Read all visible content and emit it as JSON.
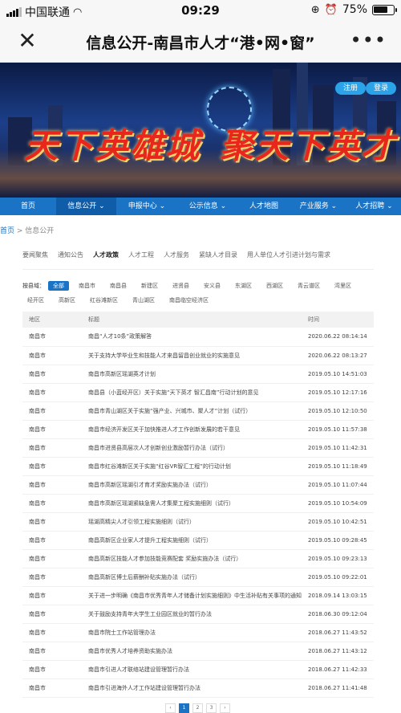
{
  "status_bar": {
    "carrier": "中国联通",
    "time": "09:29",
    "battery_text": "75%",
    "battery_level": 0.75,
    "icons": [
      "signal-icon",
      "wifi-icon",
      "rotation-lock-icon",
      "alarm-icon",
      "battery-icon"
    ]
  },
  "navbar": {
    "title": "信息公开-南昌市人才“港•网•窗”",
    "close_icon": "close-icon",
    "more_icon": "more-icon"
  },
  "banner": {
    "slogan_left": "天下英雄城",
    "slogan_right": "聚天下英才",
    "register": "注册",
    "login": "登录"
  },
  "menu": [
    {
      "label": "首页",
      "active": false
    },
    {
      "label": "信息公开 ⌄",
      "active": true
    },
    {
      "label": "申报中心 ⌄",
      "active": false
    },
    {
      "label": "公示信息 ⌄",
      "active": false
    },
    {
      "label": "人才地图",
      "active": false
    },
    {
      "label": "产业服务 ⌄",
      "active": false
    },
    {
      "label": "人才招聘 ⌄",
      "active": false
    }
  ],
  "breadcrumb": {
    "home": "首页",
    "sep": " > ",
    "current": "信息公开"
  },
  "tabs": [
    {
      "label": "要闻聚焦",
      "active": false
    },
    {
      "label": "通知公告",
      "active": false
    },
    {
      "label": "人才政策",
      "active": true
    },
    {
      "label": "人才工程",
      "active": false
    },
    {
      "label": "人才服务",
      "active": false
    },
    {
      "label": "紧缺人才目录",
      "active": false
    },
    {
      "label": "用人单位人才引进计划与需求",
      "active": false
    }
  ],
  "filter": {
    "label": "按县域：",
    "options": [
      "全部",
      "南昌市",
      "南昌县",
      "新建区",
      "进贤县",
      "安义县",
      "东湖区",
      "西湖区",
      "青云谱区",
      "湾里区",
      "经开区",
      "高新区",
      "红谷滩新区",
      "青山湖区",
      "南昌临空经济区"
    ],
    "selected": "全部"
  },
  "table": {
    "headers": [
      "地区",
      "标题",
      "时间"
    ],
    "rows": [
      [
        "南昌市",
        "南昌“人才10条”政策解答",
        "2020.06.22 08:14:14"
      ],
      [
        "南昌市",
        "关于支持大学毕业生和技能人才来昌留昌创业就业的实施意见",
        "2020.06.22 08:13:27"
      ],
      [
        "南昌市",
        "南昌市高新区瑶湖英才计划",
        "2019.05.10 14:51:03"
      ],
      [
        "南昌市",
        "南昌县（小蓝经开区）关于实施“天下英才 智汇昌南”行动计划的意见",
        "2019.05.10 12:17:16"
      ],
      [
        "南昌市",
        "南昌市青山湖区关于实施“强产业、兴城市、聚人才”计划（试行）",
        "2019.05.10 12:10:50"
      ],
      [
        "南昌市",
        "南昌市经济开发区关于加快推进人才工作创新发展的若干意见",
        "2019.05.10 11:57:38"
      ],
      [
        "南昌市",
        "南昌市进贤县高层次人才创新创业激励暂行办法（试行）",
        "2019.05.10 11:42:31"
      ],
      [
        "南昌市",
        "南昌市红谷滩新区关于实施“红谷VR智汇工程”的行动计划",
        "2019.05.10 11:18:49"
      ],
      [
        "南昌市",
        "南昌市高新区瑶湖引才育才奖励实施办法（试行）",
        "2019.05.10 11:07:44"
      ],
      [
        "南昌市",
        "南昌市高新区瑶湖紧缺急需人才集聚工程实施细则（试行）",
        "2019.05.10 10:54:09"
      ],
      [
        "南昌市",
        "瑶湖高精尖人才引领工程实施细则（试行）",
        "2019.05.10 10:42:51"
      ],
      [
        "南昌市",
        "南昌高新区企业家人才提升工程实施细则（试行）",
        "2019.05.10 09:28:45"
      ],
      [
        "南昌市",
        "南昌高新区技能人才参加技能竞赛配套 奖励实施办法（试行）",
        "2019.05.10 09:23:13"
      ],
      [
        "南昌市",
        "南昌高新区博士后薪酬补贴实施办法（试行）",
        "2019.05.10 09:22:01"
      ],
      [
        "南昌市",
        "关于进一步明确《南昌市优秀青年人才储备计划实施细则》中生活补贴有关事项的通知",
        "2018.09.14 13:03:15"
      ],
      [
        "南昌市",
        "关于鼓励支持青年大学生工业园区就业的暂行办法",
        "2018.06.30 09:12:04"
      ],
      [
        "南昌市",
        "南昌市院士工作站管理办法",
        "2018.06.27 11:43:52"
      ],
      [
        "南昌市",
        "南昌市优秀人才培养资助实施办法",
        "2018.06.27 11:43:12"
      ],
      [
        "南昌市",
        "南昌市引进人才联络站建设管理暂行办法",
        "2018.06.27 11:42:33"
      ],
      [
        "南昌市",
        "南昌市引进海外人才工作站建设管理暂行办法",
        "2018.06.27 11:41:48"
      ]
    ]
  },
  "pager": {
    "prev": "‹",
    "pages": [
      "1",
      "2",
      "3"
    ],
    "next": "›",
    "current": "1"
  }
}
